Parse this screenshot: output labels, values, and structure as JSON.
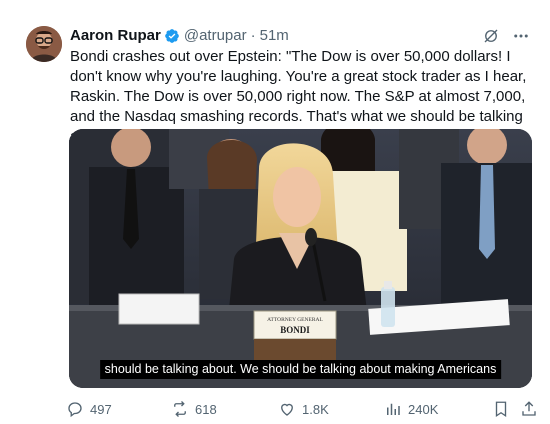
{
  "author": {
    "display_name": "Aaron Rupar",
    "handle": "@atrupar",
    "separator": "·",
    "time": "51m",
    "verified_icon": "verified-badge-icon"
  },
  "tweet": {
    "text": "Bondi crashes out over Epstein: \"The Dow is over 50,000 dollars! I don't know why you're laughing. You're a great stock trader as I hear, Raskin. The Dow is over 50,000 right now. The S&P at almost 7,000, and the Nasdaq smashing records. That's what we should be talking about.\""
  },
  "media": {
    "caption": "should be talking about. We should be talking about making Americans",
    "nameplate_title": "ATTORNEY GENERAL",
    "nameplate_name": "BONDI"
  },
  "actions": {
    "replies": "497",
    "reposts": "618",
    "likes": "1.8K",
    "views": "240K"
  },
  "colors": {
    "text_primary": "#0f1419",
    "text_secondary": "#536471",
    "verified_blue": "#1d9bf0",
    "caption_bg": "#000000"
  }
}
